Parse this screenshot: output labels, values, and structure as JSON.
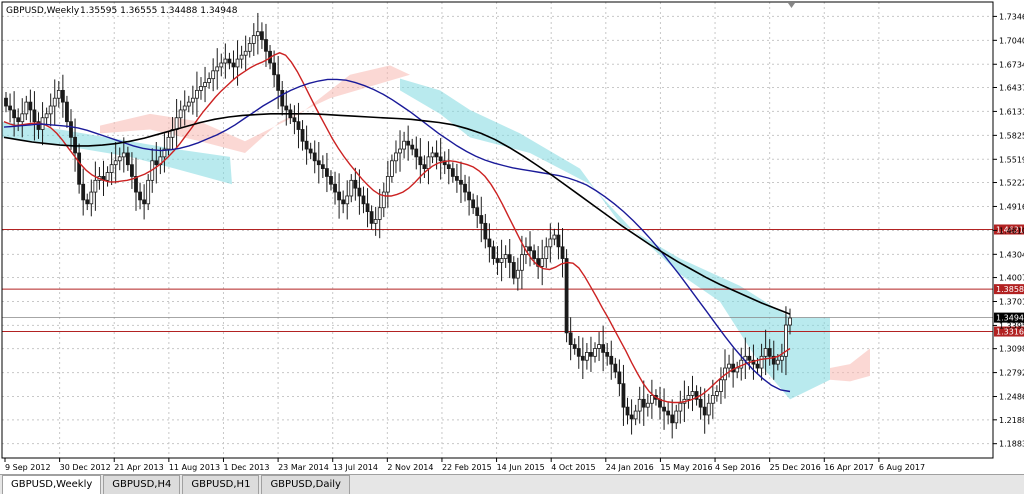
{
  "chart_title": "GBPUSD,Weekly",
  "ohlc_text": "1.35595 1.36555 1.34488 1.34948",
  "tabs": [
    {
      "label": "GBPUSD,Weekly",
      "active": true
    },
    {
      "label": "GBPUSD,H4",
      "active": false
    },
    {
      "label": "GBPUSD,H1",
      "active": false
    },
    {
      "label": "GBPUSD,Daily",
      "active": false
    }
  ],
  "chart_data": {
    "type": "candlestick",
    "symbol": "GBPUSD",
    "timeframe": "Weekly",
    "ylim": [
      1.17,
      1.753
    ],
    "y_ticks": [
      "1.18830",
      "1.21880",
      "1.24860",
      "1.27920",
      "1.30980",
      "1.33950",
      "1.37010",
      "1.40070",
      "1.43040",
      "1.46100",
      "1.49160",
      "1.52220",
      "1.55190",
      "1.58250",
      "1.61310",
      "1.64370",
      "1.67340",
      "1.70400",
      "1.73460"
    ],
    "x_labels": [
      "9 Sep 2012",
      "30 Dec 2012",
      "21 Apr 2013",
      "11 Aug 2013",
      "1 Dec 2013",
      "23 Mar 2014",
      "13 Jul 2014",
      "2 Nov 2014",
      "22 Feb 2015",
      "14 Jun 2015",
      "4 Oct 2015",
      "24 Jan 2016",
      "15 May 2016",
      "4 Sep 2016",
      "25 Dec 2016",
      "16 Apr 2017",
      "6 Aug 2017"
    ],
    "current_price": {
      "value": 1.34948,
      "label": "1.34948"
    },
    "horizontal_levels": [
      {
        "value": 1.46213,
        "label": "1.46213",
        "color": "#b22222"
      },
      {
        "value": 1.38588,
        "label": "1.38588",
        "color": "#b22222"
      },
      {
        "value": 1.33168,
        "label": "1.33168",
        "color": "#b22222"
      }
    ],
    "close_series": [
      1.62,
      1.615,
      1.605,
      1.6,
      1.61,
      1.625,
      1.615,
      1.6,
      1.59,
      1.605,
      1.61,
      1.62,
      1.63,
      1.64,
      1.625,
      1.6,
      1.58,
      1.56,
      1.52,
      1.5,
      1.495,
      1.51,
      1.525,
      1.53,
      1.525,
      1.535,
      1.545,
      1.55,
      1.555,
      1.56,
      1.545,
      1.53,
      1.51,
      1.5,
      1.495,
      1.525,
      1.55,
      1.545,
      1.555,
      1.565,
      1.58,
      1.59,
      1.605,
      1.615,
      1.62,
      1.625,
      1.63,
      1.64,
      1.645,
      1.65,
      1.655,
      1.665,
      1.67,
      1.675,
      1.68,
      1.675,
      1.67,
      1.68,
      1.685,
      1.69,
      1.7,
      1.71,
      1.715,
      1.705,
      1.69,
      1.675,
      1.66,
      1.64,
      1.62,
      1.615,
      1.605,
      1.6,
      1.59,
      1.575,
      1.565,
      1.56,
      1.55,
      1.545,
      1.54,
      1.53,
      1.52,
      1.51,
      1.5,
      1.495,
      1.505,
      1.525,
      1.515,
      1.505,
      1.495,
      1.485,
      1.47,
      1.475,
      1.49,
      1.51,
      1.53,
      1.55,
      1.56,
      1.565,
      1.575,
      1.57,
      1.565,
      1.555,
      1.545,
      1.54,
      1.555,
      1.56,
      1.555,
      1.55,
      1.545,
      1.54,
      1.53,
      1.525,
      1.52,
      1.51,
      1.5,
      1.49,
      1.48,
      1.47,
      1.45,
      1.44,
      1.425,
      1.42,
      1.425,
      1.43,
      1.42,
      1.4,
      1.41,
      1.43,
      1.44,
      1.435,
      1.425,
      1.415,
      1.425,
      1.44,
      1.45,
      1.455,
      1.44,
      1.425,
      1.33,
      1.315,
      1.31,
      1.3,
      1.295,
      1.305,
      1.3,
      1.31,
      1.315,
      1.305,
      1.3,
      1.29,
      1.28,
      1.265,
      1.235,
      1.225,
      1.22,
      1.23,
      1.245,
      1.235,
      1.24,
      1.25,
      1.245,
      1.235,
      1.23,
      1.225,
      1.215,
      1.23,
      1.24,
      1.245,
      1.25,
      1.255,
      1.245,
      1.235,
      1.225,
      1.24,
      1.25,
      1.255,
      1.27,
      1.285,
      1.29,
      1.28,
      1.285,
      1.295,
      1.3,
      1.295,
      1.29,
      1.285,
      1.3,
      1.31,
      1.3,
      1.29,
      1.295,
      1.3,
      1.34,
      1.349
    ],
    "moving_averages": [
      {
        "color": "#cc2222",
        "values": [
          1.6,
          1.597,
          1.595,
          1.596,
          1.597,
          1.598,
          1.598,
          1.596,
          1.592,
          1.585,
          1.576,
          1.566,
          1.556,
          1.546,
          1.538,
          1.532,
          1.528,
          1.525,
          1.523,
          1.523,
          1.524,
          1.525,
          1.527,
          1.53,
          1.533,
          1.537,
          1.542,
          1.548,
          1.555,
          1.563,
          1.572,
          1.582,
          1.592,
          1.603,
          1.613,
          1.622,
          1.631,
          1.639,
          1.646,
          1.653,
          1.659,
          1.664,
          1.669,
          1.673,
          1.676,
          1.68,
          1.685,
          1.688,
          1.685,
          1.676,
          1.664,
          1.65,
          1.635,
          1.62,
          1.606,
          1.592,
          1.578,
          1.566,
          1.555,
          1.545,
          1.536,
          1.527,
          1.519,
          1.512,
          1.507,
          1.505,
          1.505,
          1.507,
          1.51,
          1.515,
          1.522,
          1.53,
          1.537,
          1.543,
          1.547,
          1.549,
          1.55,
          1.549,
          1.547,
          1.545,
          1.542,
          1.537,
          1.53,
          1.52,
          1.508,
          1.494,
          1.479,
          1.464,
          1.449,
          1.435,
          1.424,
          1.416,
          1.412,
          1.411,
          1.414,
          1.418,
          1.42,
          1.419,
          1.413,
          1.402,
          1.389,
          1.376,
          1.362,
          1.349,
          1.335,
          1.321,
          1.307,
          1.292,
          1.278,
          1.265,
          1.255,
          1.248,
          1.244,
          1.242,
          1.241,
          1.241,
          1.242,
          1.244,
          1.247,
          1.251,
          1.257,
          1.264,
          1.271,
          1.277,
          1.282,
          1.286,
          1.289,
          1.292,
          1.294,
          1.296,
          1.297,
          1.298,
          1.3,
          1.305,
          1.31
        ]
      },
      {
        "color": "#1a1a99",
        "values": [
          1.593,
          1.594,
          1.595,
          1.596,
          1.597,
          1.596,
          1.595,
          1.594,
          1.592,
          1.589,
          1.585,
          1.581,
          1.577,
          1.573,
          1.569,
          1.566,
          1.564,
          1.563,
          1.564,
          1.566,
          1.569,
          1.573,
          1.578,
          1.583,
          1.589,
          1.596,
          1.604,
          1.612,
          1.62,
          1.627,
          1.634,
          1.64,
          1.645,
          1.649,
          1.652,
          1.654,
          1.654,
          1.653,
          1.65,
          1.646,
          1.641,
          1.635,
          1.628,
          1.62,
          1.612,
          1.603,
          1.594,
          1.585,
          1.577,
          1.569,
          1.562,
          1.556,
          1.551,
          1.547,
          1.544,
          1.541,
          1.539,
          1.537,
          1.535,
          1.533,
          1.531,
          1.528,
          1.524,
          1.519,
          1.512,
          1.504,
          1.495,
          1.485,
          1.474,
          1.462,
          1.449,
          1.435,
          1.42,
          1.405,
          1.389,
          1.373,
          1.357,
          1.341,
          1.325,
          1.31,
          1.296,
          1.283,
          1.272,
          1.263,
          1.257,
          1.255
        ]
      }
    ],
    "long_ma": {
      "color": "#000000",
      "values": [
        1.58,
        1.577,
        1.574,
        1.572,
        1.57,
        1.569,
        1.569,
        1.57,
        1.572,
        1.575,
        1.579,
        1.584,
        1.589,
        1.594,
        1.599,
        1.603,
        1.606,
        1.608,
        1.609,
        1.61,
        1.61,
        1.61,
        1.61,
        1.609,
        1.608,
        1.607,
        1.606,
        1.605,
        1.604,
        1.603,
        1.601,
        1.599,
        1.596,
        1.591,
        1.585,
        1.577,
        1.567,
        1.556,
        1.544,
        1.532,
        1.519,
        1.506,
        1.493,
        1.48,
        1.467,
        1.455,
        1.443,
        1.432,
        1.421,
        1.411,
        1.401,
        1.392,
        1.384,
        1.376,
        1.368,
        1.361,
        1.354
      ]
    }
  }
}
